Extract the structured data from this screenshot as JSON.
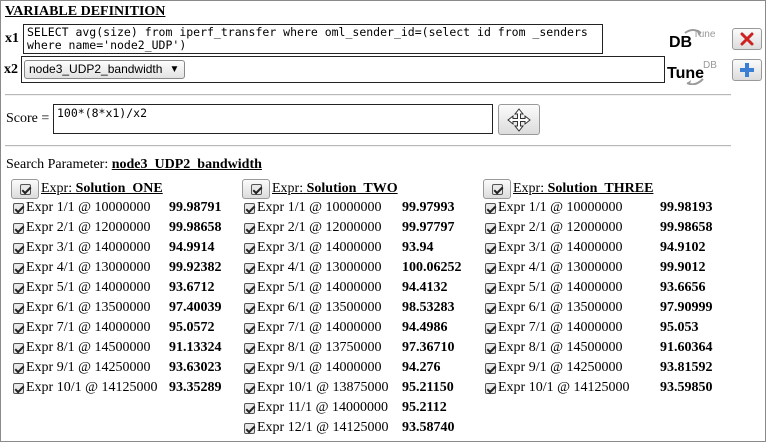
{
  "title": "VARIABLE DEFINITION",
  "x1": {
    "label": "x1",
    "query": "SELECT avg(size) from iperf_transfer where oml_sender_id=(select id from _senders\nwhere name='node2_UDP')"
  },
  "x2": {
    "label": "x2",
    "selected": "node3_UDP2_bandwidth"
  },
  "dbtune_icon": {
    "top_text": "DB",
    "top_sub": "Tune",
    "bottom_text": "Tune",
    "bottom_sub": "DB"
  },
  "buttons": {
    "delete_icon": "close-icon",
    "add_icon": "plus-icon",
    "delete_color": "#cc2222",
    "add_color": "#3a7fd4"
  },
  "score": {
    "label": "Score =",
    "expression": "100*(8*x1)/x2"
  },
  "search": {
    "label": "Search Parameter:",
    "value": "node3_UDP2_bandwidth"
  },
  "solutions": [
    {
      "expr_label": "Expr:",
      "name": "Solution_ONE",
      "rows": [
        {
          "label": "Expr 1/1 @ 10000000",
          "value": "99.98791"
        },
        {
          "label": "Expr 2/1 @ 12000000",
          "value": "99.98658"
        },
        {
          "label": "Expr 3/1 @ 14000000",
          "value": "94.9914"
        },
        {
          "label": "Expr 4/1 @ 13000000",
          "value": "99.92382"
        },
        {
          "label": "Expr 5/1 @ 14000000",
          "value": "93.6712"
        },
        {
          "label": "Expr 6/1 @ 13500000",
          "value": "97.40039"
        },
        {
          "label": "Expr 7/1 @ 14000000",
          "value": "95.0572"
        },
        {
          "label": "Expr 8/1 @ 14500000",
          "value": "91.13324"
        },
        {
          "label": "Expr 9/1 @ 14250000",
          "value": "93.63023"
        },
        {
          "label": "Expr 10/1 @ 14125000",
          "value": "93.35289"
        }
      ]
    },
    {
      "expr_label": "Expr:",
      "name": "Solution_TWO",
      "rows": [
        {
          "label": "Expr 1/1 @ 10000000",
          "value": "99.97993"
        },
        {
          "label": "Expr 2/1 @ 12000000",
          "value": "99.97797"
        },
        {
          "label": "Expr 3/1 @ 14000000",
          "value": "93.94"
        },
        {
          "label": "Expr 4/1 @ 13000000",
          "value": "100.06252"
        },
        {
          "label": "Expr 5/1 @ 14000000",
          "value": "94.4132"
        },
        {
          "label": "Expr 6/1 @ 13500000",
          "value": "98.53283"
        },
        {
          "label": "Expr 7/1 @ 14000000",
          "value": "94.4986"
        },
        {
          "label": "Expr 8/1 @ 13750000",
          "value": "97.36710"
        },
        {
          "label": "Expr 9/1 @ 14000000",
          "value": "94.276"
        },
        {
          "label": "Expr 10/1 @ 13875000",
          "value": "95.21150"
        },
        {
          "label": "Expr 11/1 @ 14000000",
          "value": "95.2112"
        },
        {
          "label": "Expr 12/1 @ 14125000",
          "value": "93.58740"
        }
      ]
    },
    {
      "expr_label": "Expr:",
      "name": "Solution_THREE",
      "rows": [
        {
          "label": "Expr 1/1 @ 10000000",
          "value": "99.98193"
        },
        {
          "label": "Expr 2/1 @ 12000000",
          "value": "99.98658"
        },
        {
          "label": "Expr 3/1 @ 14000000",
          "value": "94.9102"
        },
        {
          "label": "Expr 4/1 @ 13000000",
          "value": "99.9012"
        },
        {
          "label": "Expr 5/1 @ 14000000",
          "value": "93.6656"
        },
        {
          "label": "Expr 6/1 @ 13500000",
          "value": "97.90999"
        },
        {
          "label": "Expr 7/1 @ 14000000",
          "value": "95.053"
        },
        {
          "label": "Expr 8/1 @ 14500000",
          "value": "91.60364"
        },
        {
          "label": "Expr 9/1 @ 14250000",
          "value": "93.81592"
        },
        {
          "label": "Expr 10/1 @ 14125000",
          "value": "93.59850"
        }
      ]
    }
  ]
}
